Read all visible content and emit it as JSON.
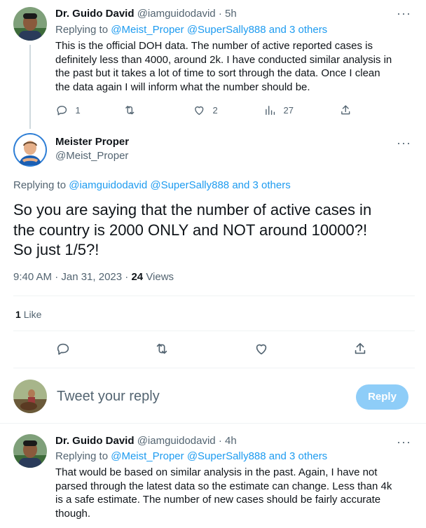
{
  "tweet1": {
    "name": "Dr. Guido David",
    "handle": "@iamguidodavid",
    "dot": "·",
    "time": "5h",
    "replying_prefix": "Replying to",
    "replying_users": "@Meist_Proper @SuperSally888",
    "replying_and": "and",
    "replying_others": "3 others",
    "lines": [
      "This is the official DOH data. The number of active reported cases is",
      "definitely less than 4000, around 2k. I have conducted similar analysis in",
      "the past but it takes a lot of time to sort through the data. Once I clean",
      "the data again I will inform what the number should be."
    ],
    "replies": "1",
    "retweets": "",
    "likes": "2",
    "views": "27"
  },
  "main_tweet": {
    "name": "Meister Proper",
    "handle": "@Meist_Proper",
    "replying_prefix": "Replying to",
    "replying_users": "@iamguidodavid @SuperSally888",
    "replying_and": "and",
    "replying_others": "3 others",
    "lines": [
      "So you are saying that the number of active cases in",
      "the country is 2000 ONLY and NOT around 10000?!",
      "So just 1/5?!"
    ],
    "timestamp": "9:40 AM · Jan 31, 2023 ·",
    "views_count": "24",
    "views_label": "Views",
    "likes_count": "1",
    "likes_label": "Like"
  },
  "composer": {
    "placeholder": "Tweet your reply",
    "button": "Reply"
  },
  "tweet3": {
    "name": "Dr. Guido David",
    "handle": "@iamguidodavid",
    "dot": "·",
    "time": "4h",
    "replying_prefix": "Replying to",
    "replying_users": "@Meist_Proper @SuperSally888",
    "replying_and": "and",
    "replying_others": "3 others",
    "lines": [
      "That would be based on similar analysis in the past. Again, I have not",
      "parsed through the latest data so the estimate can change. Less than 4k",
      "is a safe estimate. The number of new cases should be fairly accurate",
      "though."
    ]
  },
  "icons": {
    "more": "more-icon",
    "reply": "reply-icon",
    "retweet": "retweet-icon",
    "like": "like-icon",
    "views": "views-icon",
    "share": "share-icon"
  },
  "colors": {
    "link": "#1d9bf0",
    "muted": "#536471",
    "reply_button": "#8ecdf8",
    "divider": "#eff3f4",
    "thread_line": "#cfd9de"
  }
}
